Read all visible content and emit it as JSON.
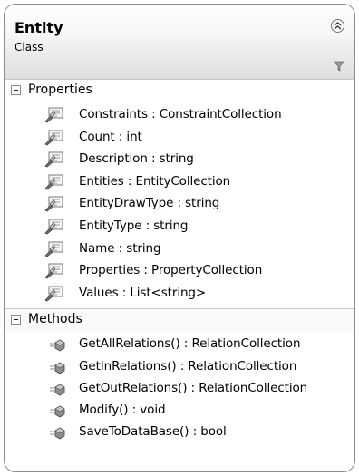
{
  "entity": {
    "name": "Entity",
    "stereotype": "Class"
  },
  "icons": {
    "collapse": "double-chevron-up-icon",
    "filter": "funnel-filter-icon",
    "property": "property-icon",
    "method": "method-icon"
  },
  "properties_section": {
    "label": "Properties",
    "items": [
      "Constraints : ConstraintCollection",
      "Count : int",
      "Description : string",
      "Entities : EntityCollection",
      "EntityDrawType : string",
      "EntityType : string",
      "Name : string",
      "Properties : PropertyCollection",
      "Values : List<string>"
    ]
  },
  "methods_section": {
    "label": "Methods",
    "items": [
      "GetAllRelations() : RelationCollection",
      "GetInRelations() : RelationCollection",
      "GetOutRelations() : RelationCollection",
      "Modify() : void",
      "SaveToDataBase() : bool"
    ]
  }
}
